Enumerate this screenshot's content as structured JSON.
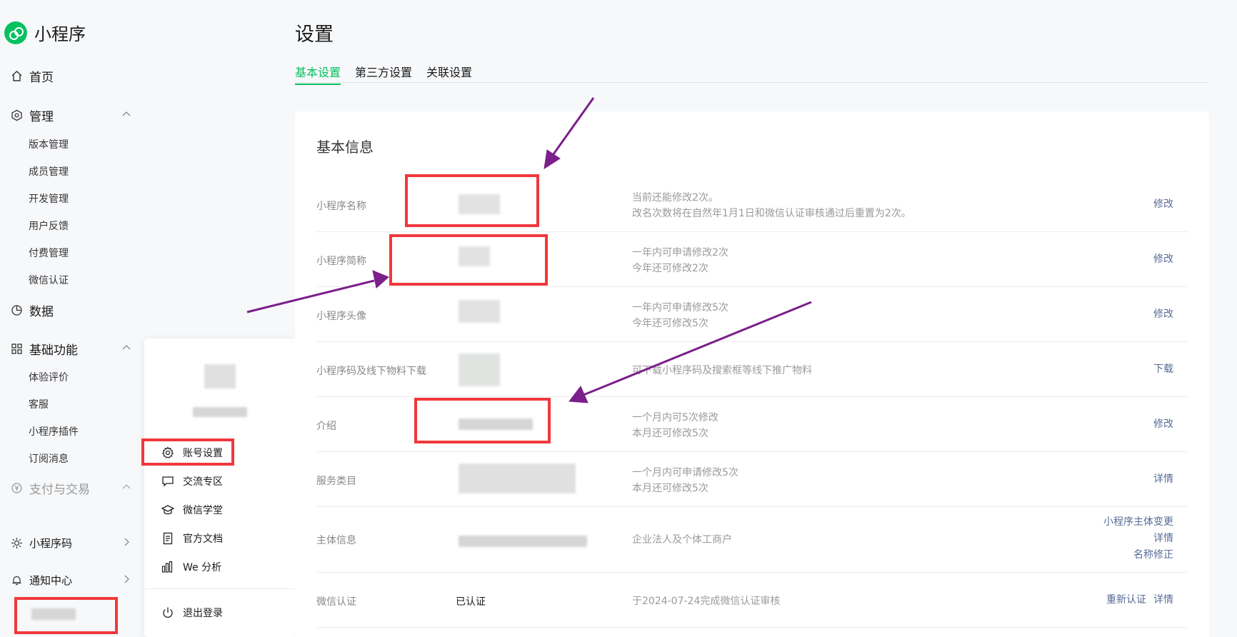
{
  "brand": {
    "name": "小程序"
  },
  "sidebar": {
    "home": "首页",
    "manage": {
      "label": "管理",
      "items": [
        "版本管理",
        "成员管理",
        "开发管理",
        "用户反馈",
        "付费管理",
        "微信认证"
      ]
    },
    "data": "数据",
    "basic": {
      "label": "基础功能",
      "items": [
        "体验评价",
        "客服",
        "小程序插件",
        "订阅消息"
      ]
    },
    "payment": "支付与交易",
    "qrcode": "小程序码",
    "notify": "通知中心"
  },
  "popup": {
    "items": [
      "账号设置",
      "交流专区",
      "微信学堂",
      "官方文档",
      "We 分析"
    ],
    "logout": "退出登录"
  },
  "page": {
    "title": "设置",
    "tabs": [
      "基本设置",
      "第三方设置",
      "关联设置"
    ],
    "active_tab": "基本设置"
  },
  "card": {
    "title": "基本信息",
    "rows": [
      {
        "label": "小程序名称",
        "desc": [
          "当前还能修改2次。",
          "改名次数将在自然年1月1日和微信认证审核通过后重置为2次。"
        ],
        "actions": [
          "修改"
        ]
      },
      {
        "label": "小程序简称",
        "desc": [
          "一年内可申请修改2次",
          "今年还可修改2次"
        ],
        "actions": [
          "修改"
        ]
      },
      {
        "label": "小程序头像",
        "desc": [
          "一年内可申请修改5次",
          "今年还可修改5次"
        ],
        "actions": [
          "修改"
        ]
      },
      {
        "label": "小程序码及线下物料下载",
        "desc": [
          "可下载小程序码及搜索框等线下推广物料"
        ],
        "actions": [
          "下载"
        ]
      },
      {
        "label": "介绍",
        "desc": [
          "一个月内可5次修改",
          "本月还可修改5次"
        ],
        "actions": [
          "修改"
        ]
      },
      {
        "label": "服务类目",
        "desc": [
          "一个月内可申请修改5次",
          "本月还可修改5次"
        ],
        "actions": [
          "详情"
        ]
      },
      {
        "label": "主体信息",
        "desc": [
          "企业法人及个体工商户"
        ],
        "actions": [
          "小程序主体变更",
          "详情",
          "名称修正"
        ]
      },
      {
        "label": "微信认证",
        "value": "已认证",
        "desc": [
          "于2024-07-24完成微信认证审核"
        ],
        "actions": [
          "重新认证",
          "详情"
        ]
      }
    ]
  },
  "colors": {
    "accent": "#07c160",
    "link": "#576b95",
    "highlight": "#f0383c",
    "arrow": "#7b1f8a"
  }
}
